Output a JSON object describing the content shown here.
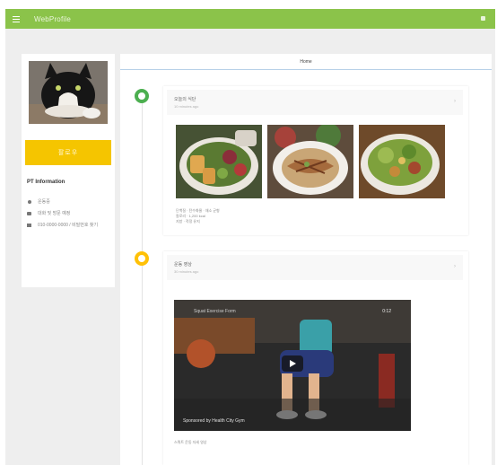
{
  "topbar": {
    "title": "WebProfile",
    "menu_icon": "menu-icon",
    "more_icon": "more-icon",
    "color": "#8bc34a"
  },
  "profile": {
    "button_label": "팔로우",
    "info_heading": "PT Information",
    "info_items": [
      {
        "icon": "location-icon",
        "text": "운동중"
      },
      {
        "icon": "chat-icon",
        "text": "대화 및 방문 예정"
      },
      {
        "icon": "mail-icon",
        "text": "010-0000-0000 / 비밀번호 찾기"
      }
    ],
    "button_color": "#f5c500"
  },
  "tabs": [
    {
      "label": "Home",
      "active": true
    }
  ],
  "posts": [
    {
      "title": "오늘의 식단",
      "time": "10 minutes ago",
      "marker_color": "#4caf50",
      "photos": [
        "salad-bowl-photo",
        "noodle-soup-photo",
        "vegetable-salad-photo"
      ],
      "text_lines": [
        "단백질 · 탄수화물 · 채소 균형",
        "칼로리 · 1,200 kcal",
        "지방 · 적정 유지"
      ]
    },
    {
      "title": "운동 영상",
      "time": "30 minutes ago",
      "marker_color": "#ffc107",
      "video": {
        "title": "Squat Exercise Form",
        "time": "0:12",
        "caption": "Sponsored by Health City Gym"
      },
      "footer": "스쿼트 운동 자세 영상"
    }
  ]
}
